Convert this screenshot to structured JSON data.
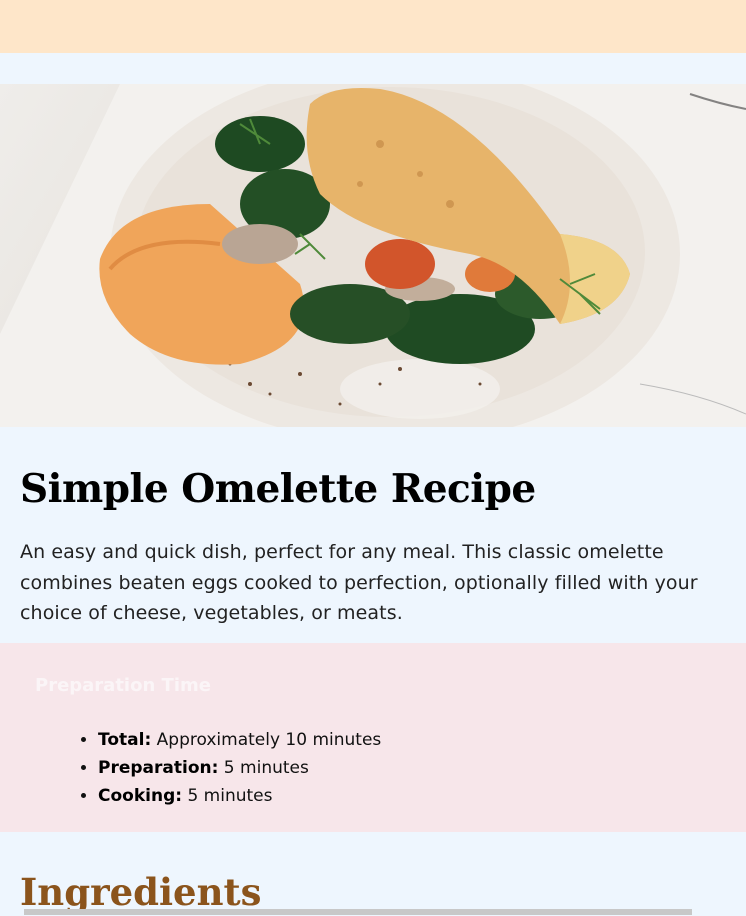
{
  "header": {
    "bg_color": "#fee6c9"
  },
  "hero": {
    "image_subject": "omelette-on-plate-image"
  },
  "recipe": {
    "title": "Simple Omelette Recipe",
    "description": "An easy and quick dish, perfect for any meal. This classic omelette combines beaten eggs cooked to perfection, optionally filled with your choice of cheese, vegetables, or meats."
  },
  "prep_time": {
    "heading": "Preparation Time",
    "items": [
      {
        "label": "Total:",
        "value": " Approximately 10 minutes"
      },
      {
        "label": "Preparation:",
        "value": " 5 minutes"
      },
      {
        "label": "Cooking:",
        "value": " 5 minutes"
      }
    ]
  },
  "ingredients": {
    "heading": "Ingredients"
  },
  "colors": {
    "page_bg": "#eef6fe",
    "prep_bg": "#f7e6ea",
    "ingredients_heading": "#8b541c"
  }
}
